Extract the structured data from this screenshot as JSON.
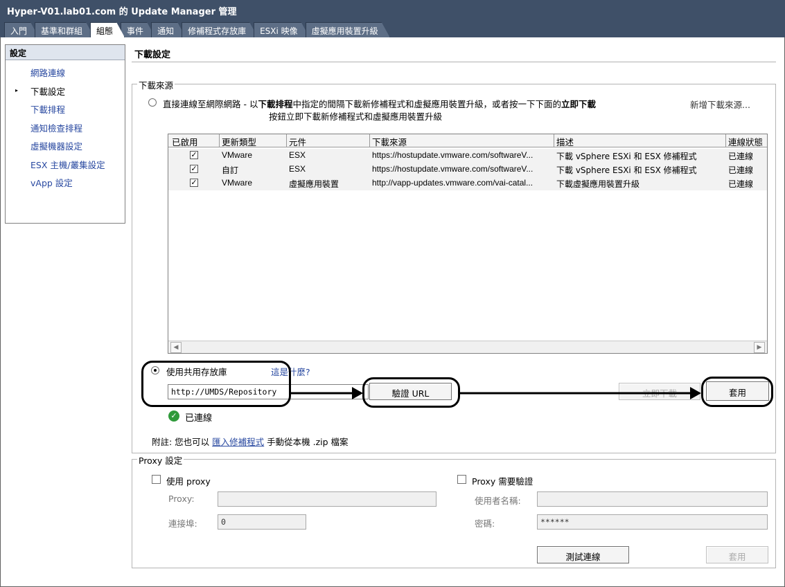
{
  "window": {
    "title": "Hyper-V01.lab01.com 的 Update Manager 管理"
  },
  "tabs": [
    {
      "label": "入門"
    },
    {
      "label": "基準和群組"
    },
    {
      "label": "組態"
    },
    {
      "label": "事件"
    },
    {
      "label": "通知"
    },
    {
      "label": "修補程式存放庫"
    },
    {
      "label": "ESXi 映像"
    },
    {
      "label": "虛擬應用裝置升級"
    }
  ],
  "sidebar": {
    "header": "設定",
    "items": [
      {
        "label": "網路連線"
      },
      {
        "label": "下載設定"
      },
      {
        "label": "下載排程"
      },
      {
        "label": "通知檢查排程"
      },
      {
        "label": "虛擬機器設定"
      },
      {
        "label": "ESX 主機/叢集設定"
      },
      {
        "label": "vApp 設定"
      }
    ]
  },
  "main": {
    "heading": "下載設定",
    "download_source": {
      "legend": "下載來源",
      "direct_option": "直接連線至網際網路",
      "desc_part1": " - 以",
      "desc_bold1": "下載排程",
      "desc_part2": "中指定的間隔下載新修補程式和虛擬應用裝置升級，或者按一下下面的",
      "desc_bold2": "立即下載",
      "desc_line2": "按鈕立即下載新修補程式和虛擬應用裝置升級",
      "add_source_link": "新增下載來源..."
    },
    "table": {
      "columns": [
        "已啟用",
        "更新類型",
        "元件",
        "下載來源",
        "描述",
        "連線狀態"
      ],
      "rows": [
        {
          "enabled": "✓",
          "type": "VMware",
          "component": "ESX",
          "source": "https://hostupdate.vmware.com/softwareV...",
          "description": "下載 vSphere ESXi 和 ESX 修補程式",
          "status": "已連線"
        },
        {
          "enabled": "✓",
          "type": "自訂",
          "component": "ESX",
          "source": "https://hostupdate.vmware.com/softwareV...",
          "description": "下載 vSphere ESXi 和 ESX 修補程式",
          "status": "已連線"
        },
        {
          "enabled": "✓",
          "type": "VMware",
          "component": "虛擬應用裝置",
          "source": "http://vapp-updates.vmware.com/vai-catal...",
          "description": "下載虛擬應用裝置升級",
          "status": "已連線"
        }
      ]
    },
    "shared_repo": {
      "option_label": "使用共用存放庫",
      "help_link": "這是什麼?",
      "url_value": "http://UMDS/Repository",
      "validate_button": "驗證 URL",
      "download_now_button": "立即下載",
      "apply_button": "套用",
      "status_text": "已連線",
      "note_prefix": "附註: 您也可以",
      "note_link": "匯入修補程式",
      "note_suffix": "手動從本機 .zip 檔案"
    },
    "proxy": {
      "legend": "Proxy 設定",
      "use_proxy_label": "使用 proxy",
      "auth_label": "Proxy 需要驗證",
      "proxy_label": "Proxy:",
      "port_label": "連接埠:",
      "port_value": "0",
      "username_label": "使用者名稱:",
      "password_label": "密碼:",
      "password_value": "******",
      "test_button": "測試連線",
      "apply_button": "套用"
    }
  }
}
